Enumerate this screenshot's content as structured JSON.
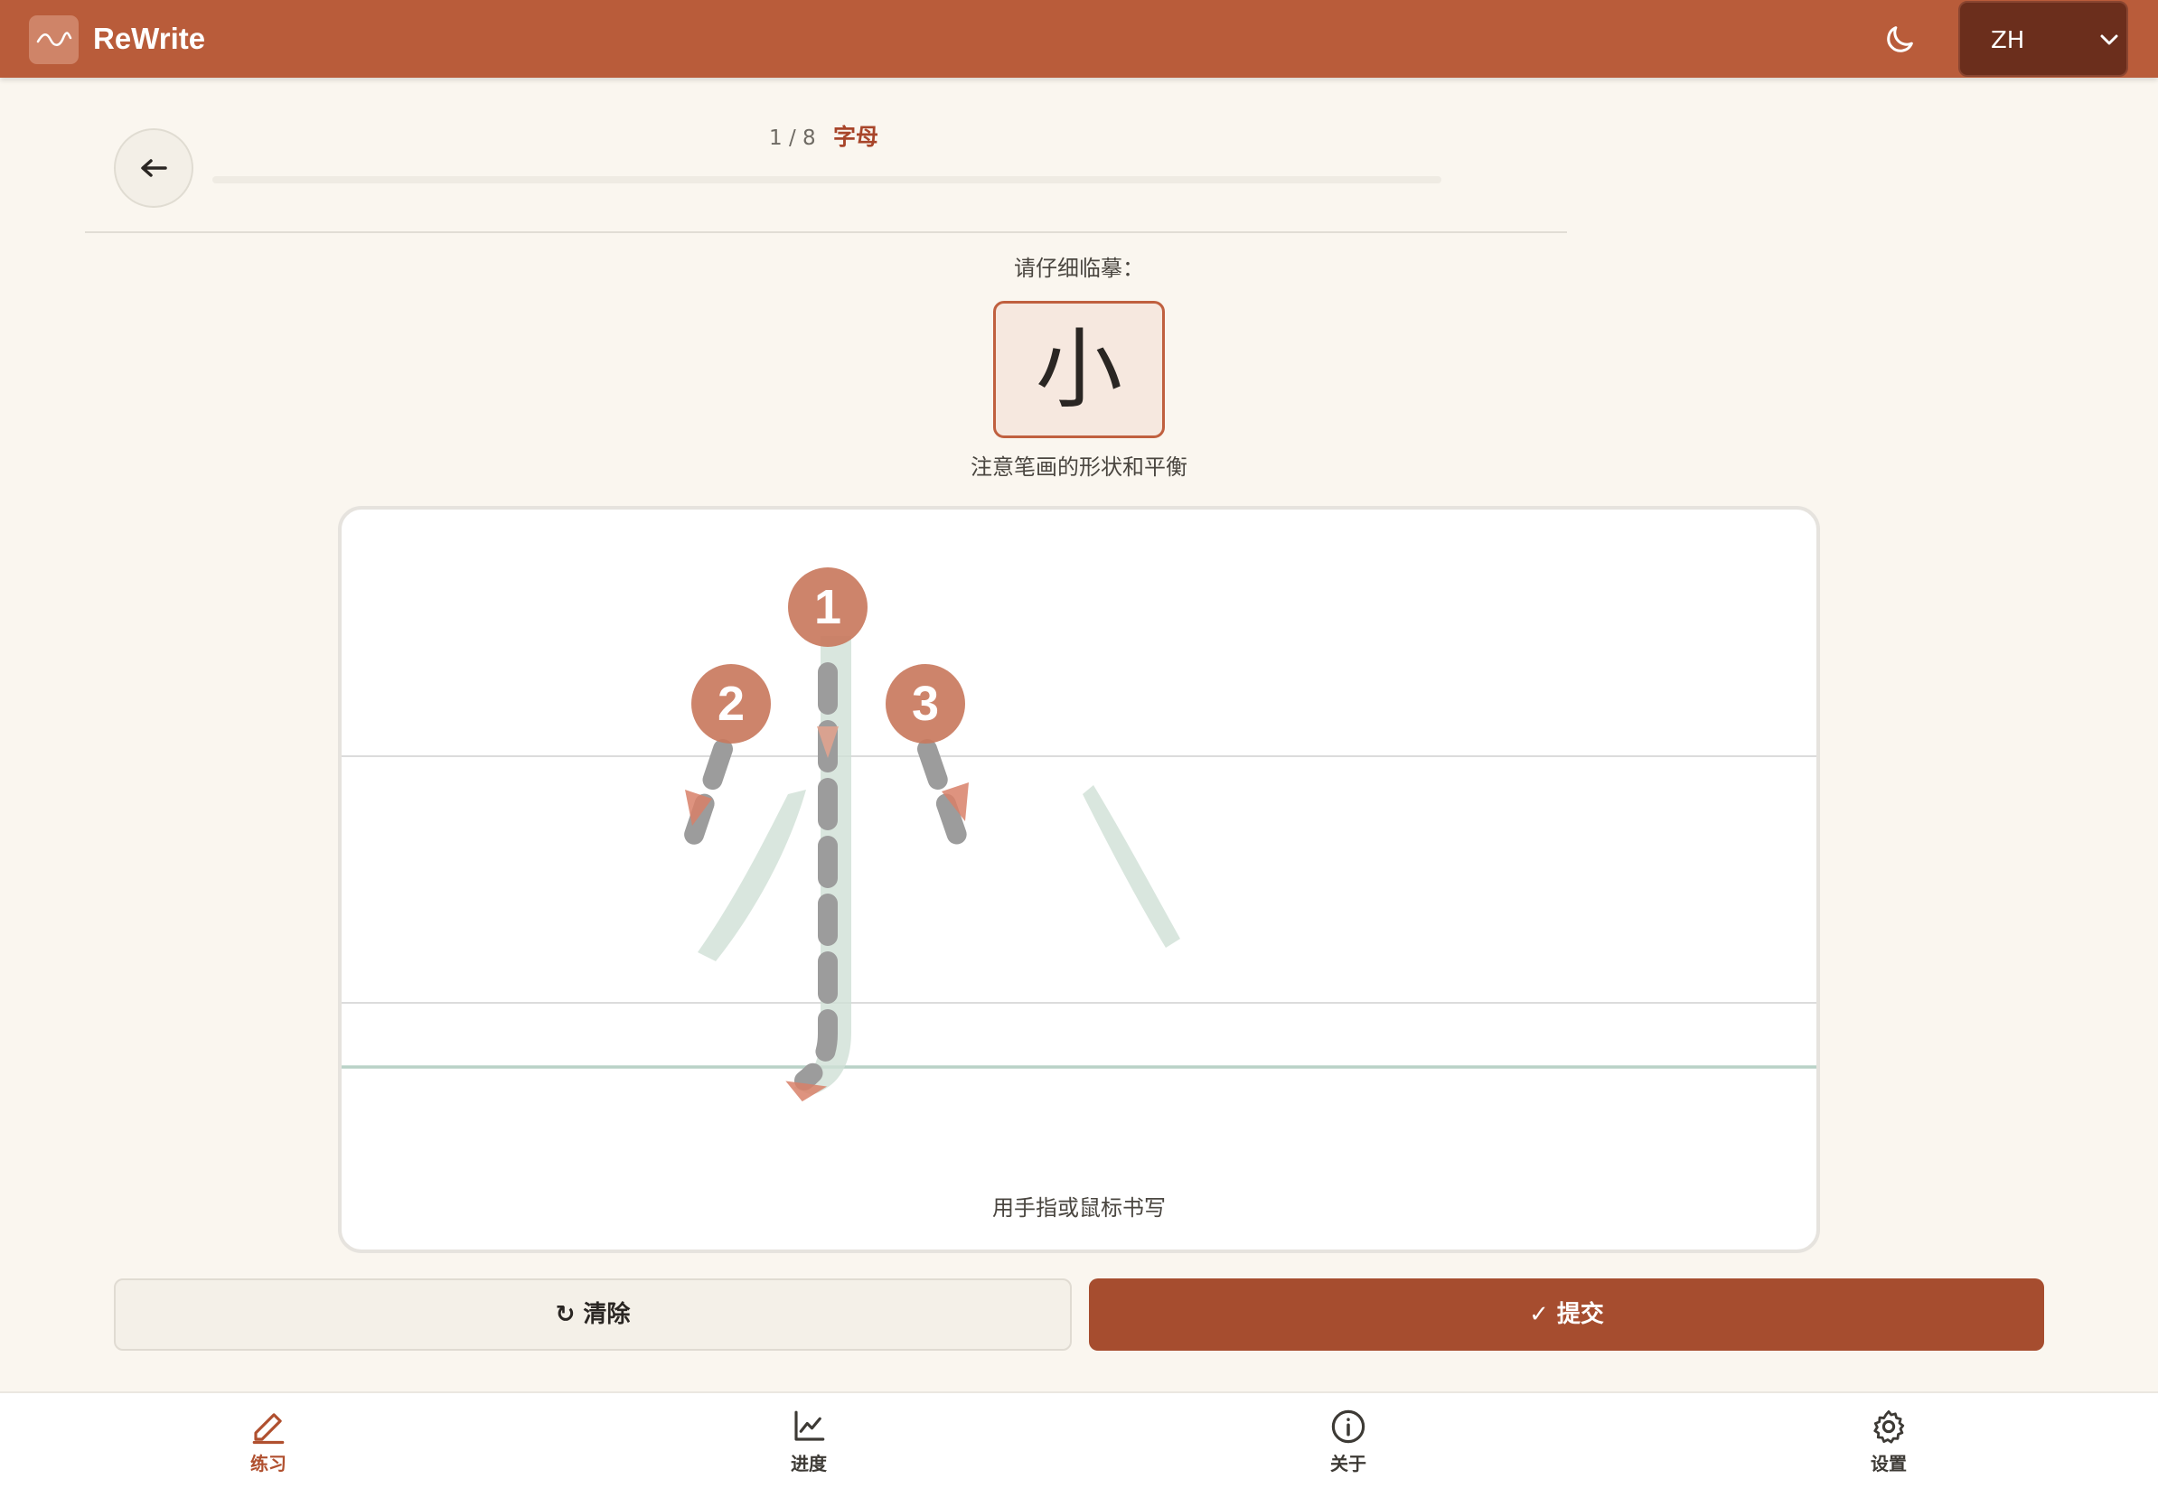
{
  "app": {
    "title": "ReWrite",
    "language": "ZH"
  },
  "lesson": {
    "progress": "1 / 8",
    "category": "字母",
    "completed_fraction": 0.0
  },
  "prompt": {
    "label": "请仔细临摹：",
    "character": "小",
    "hint": "注意笔画的形状和平衡"
  },
  "canvas": {
    "instruction": "用手指或鼠标书写",
    "stroke_numbers": [
      "1",
      "2",
      "3"
    ]
  },
  "actions": {
    "clear": "↻ 清除",
    "submit": "✓ 提交"
  },
  "nav": {
    "items": [
      {
        "label": "练习",
        "icon": "pencil-icon",
        "active": true
      },
      {
        "label": "进度",
        "icon": "chart-icon",
        "active": false
      },
      {
        "label": "关于",
        "icon": "info-icon",
        "active": false
      },
      {
        "label": "设置",
        "icon": "gear-icon",
        "active": false
      }
    ]
  },
  "colors": {
    "header": "#b95c3a",
    "accent": "#a64d2f",
    "stroke_marker": "#c97a5e",
    "guide": "#cfe0d6",
    "background": "#faf6ef"
  }
}
